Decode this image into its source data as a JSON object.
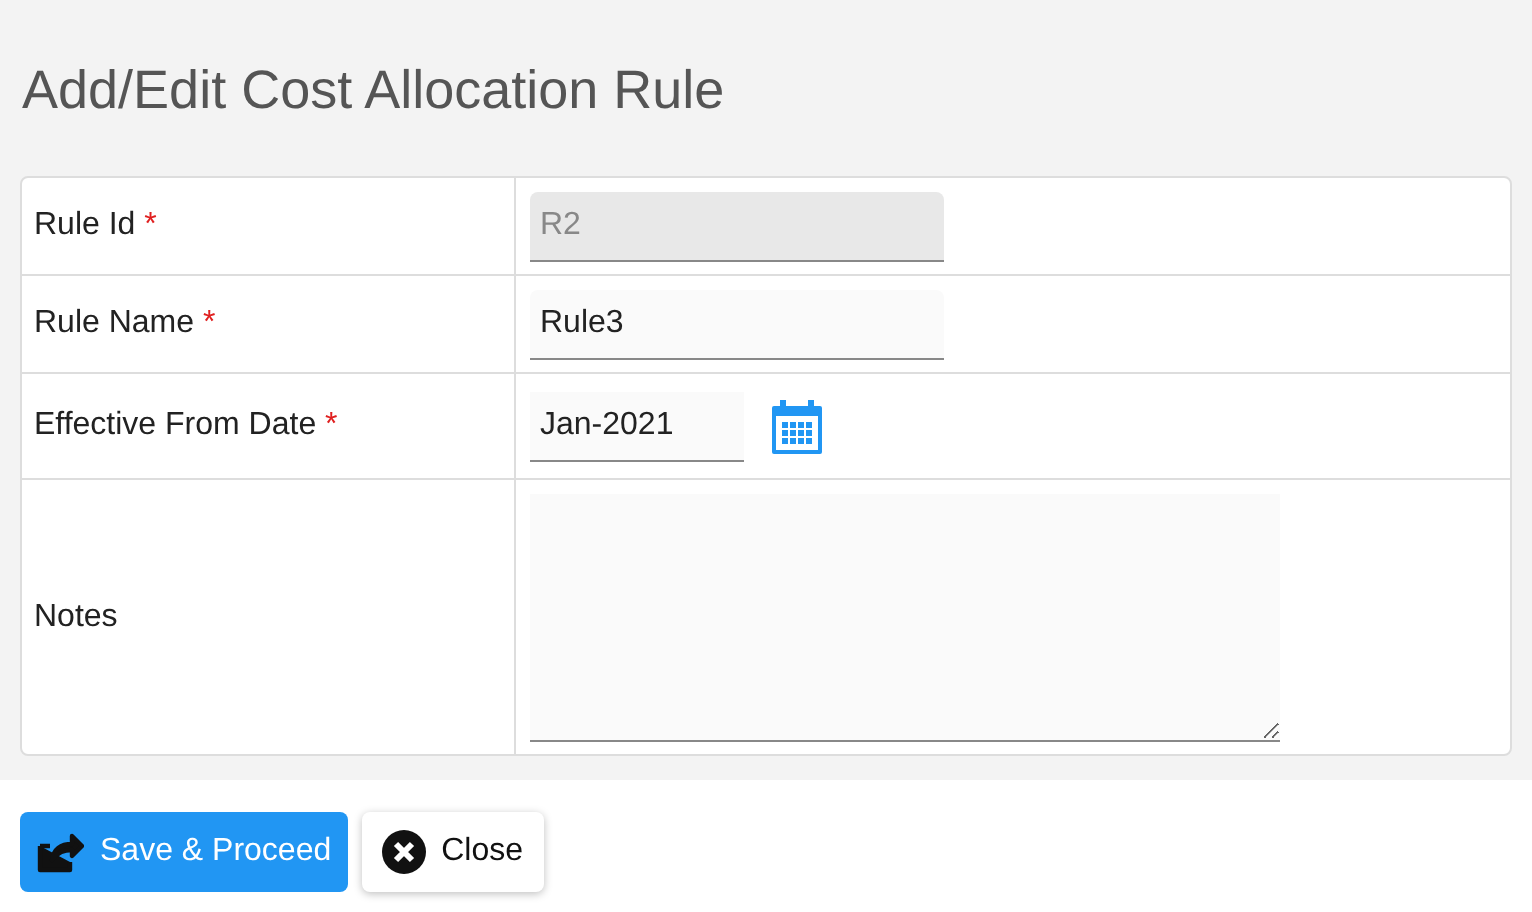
{
  "title": "Add/Edit Cost Allocation Rule",
  "fields": [
    {
      "label": "Rule Id",
      "required": true,
      "kind": "text",
      "value": "R2",
      "disabled": true
    },
    {
      "label": "Rule Name",
      "required": true,
      "kind": "text",
      "value": "Rule3",
      "disabled": false
    },
    {
      "label": "Effective From Date",
      "required": true,
      "kind": "date",
      "value": "Jan-2021",
      "disabled": false
    },
    {
      "label": "Notes",
      "required": false,
      "kind": "textarea",
      "disabled": false
    }
  ],
  "required_mark": "*",
  "buttons": [
    {
      "label": "Save & Proceed",
      "kind": "primary"
    },
    {
      "label": "Close",
      "kind": "secondary"
    }
  ]
}
